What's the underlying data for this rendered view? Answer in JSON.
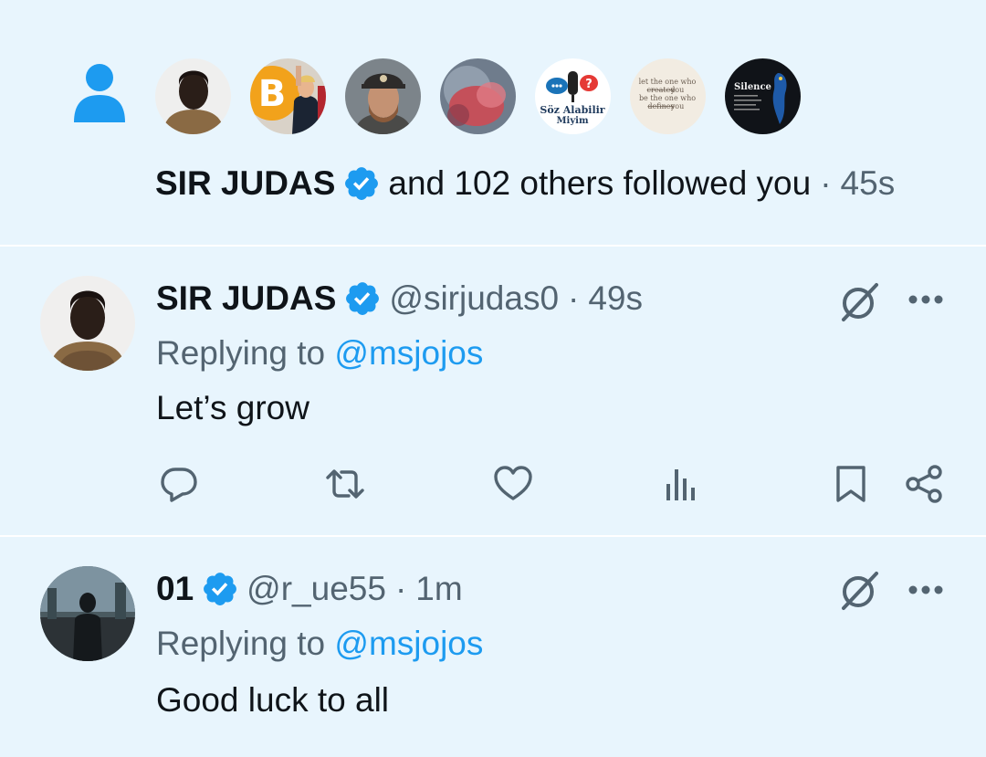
{
  "follow": {
    "name": "SIR JUDAS",
    "text": "and 102 others followed you",
    "dot": "·",
    "time": "45s",
    "avatars": [
      {
        "icon": "avatar-man-hoodie"
      },
      {
        "icon": "avatar-bitcoin-trump"
      },
      {
        "icon": "avatar-man-cap-beard"
      },
      {
        "icon": "avatar-red-blur"
      },
      {
        "icon": "avatar-soz-alabilir-miyim",
        "label": "Söz Alabilir Miyim"
      },
      {
        "icon": "avatar-text-quote",
        "label": "let the one who ... you be the one who ... you"
      },
      {
        "icon": "avatar-silence-bird",
        "label": "Silence"
      }
    ]
  },
  "replies": [
    {
      "name": "SIR JUDAS",
      "handle": "@sirjudas0",
      "dot": "·",
      "time": "49s",
      "replying_prefix": "Replying to",
      "mention": "@msjojos",
      "text": "Let’s grow"
    },
    {
      "name": "01",
      "handle": "@r_ue55",
      "dot": "·",
      "time": "1m",
      "replying_prefix": "Replying to",
      "mention": "@msjojos",
      "text": "Good luck to all"
    }
  ],
  "colors": {
    "background": "#e8f5fd",
    "accent": "#1d9bf0",
    "muted": "#536471",
    "text": "#0f1419"
  }
}
